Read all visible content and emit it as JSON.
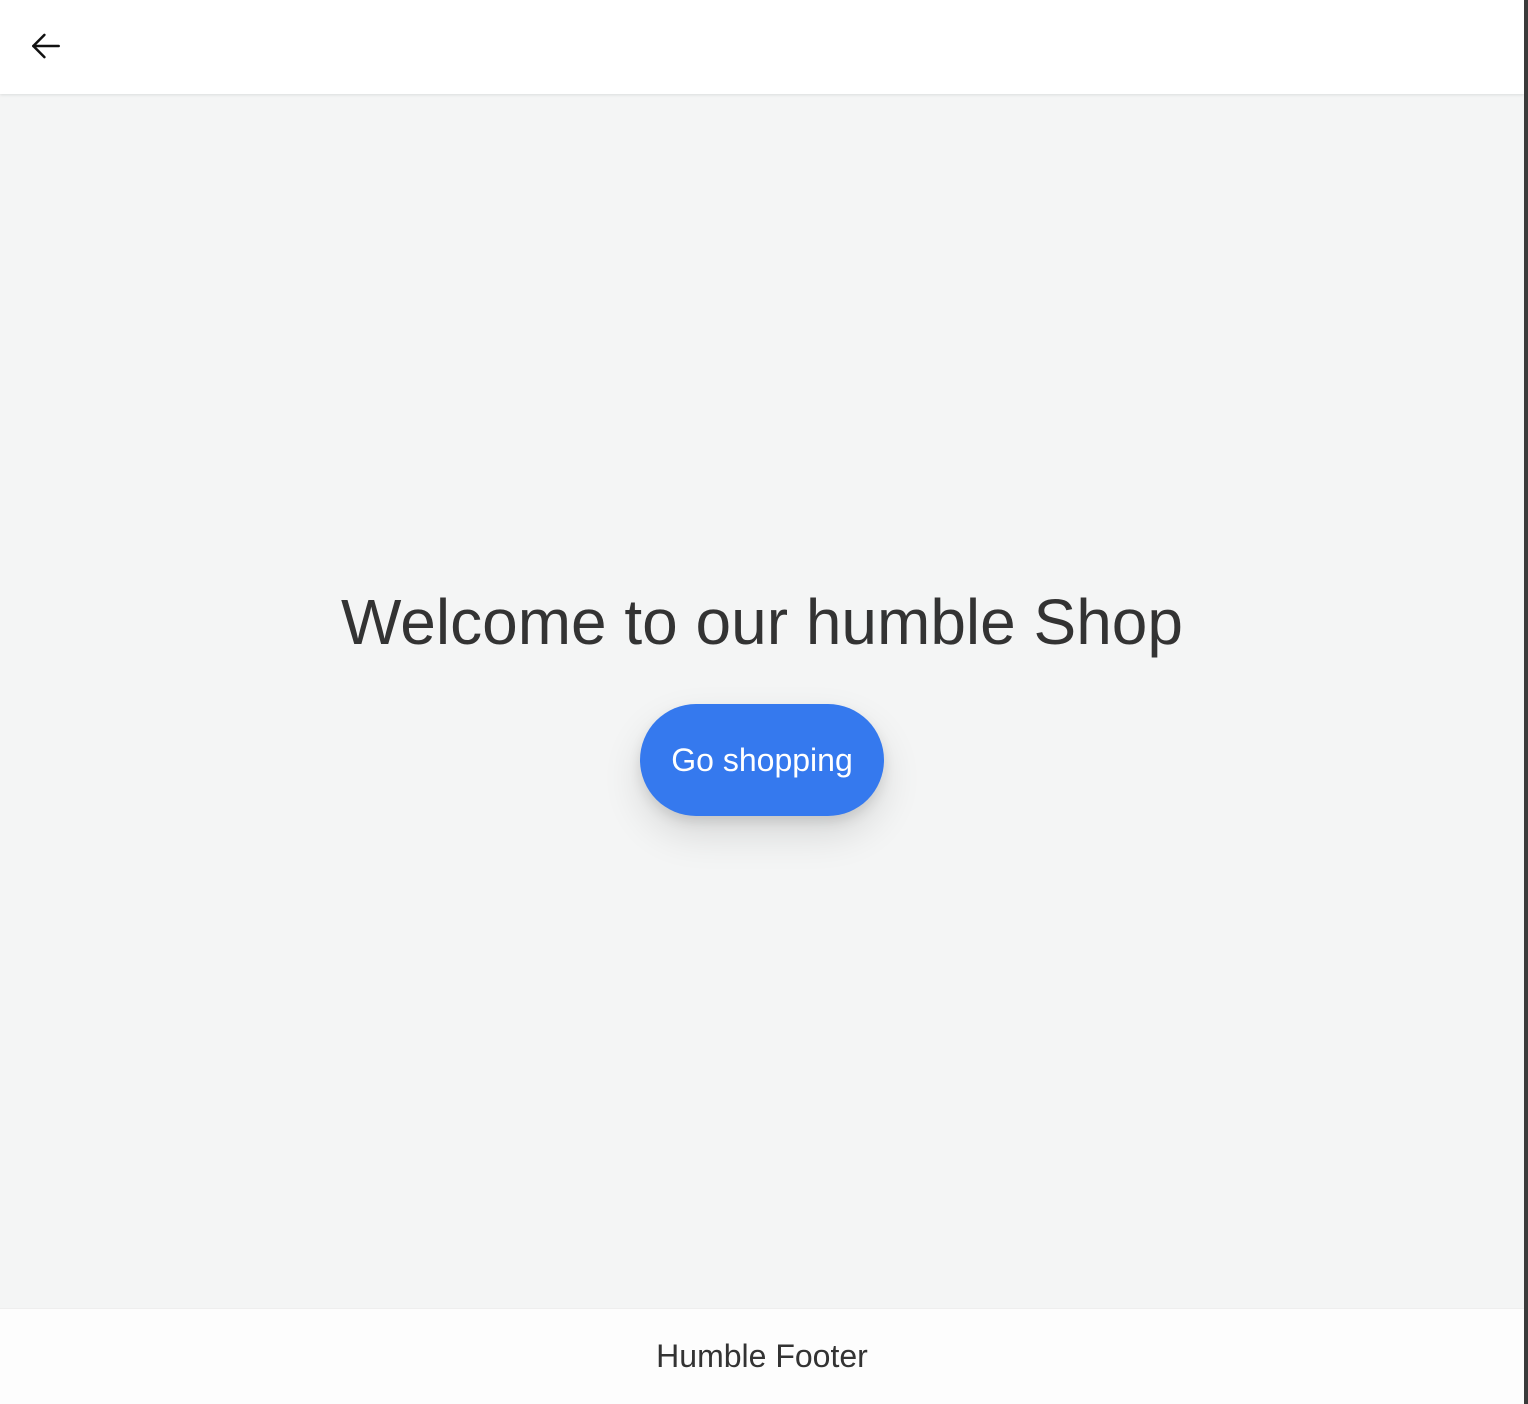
{
  "header": {
    "back_icon": "arrow-left-icon"
  },
  "main": {
    "title": "Welcome to our humble Shop",
    "cta_label": "Go shopping"
  },
  "footer": {
    "text": "Humble Footer"
  },
  "colors": {
    "background": "#f4f5f5",
    "header_bg": "#ffffff",
    "cta_bg": "#3579ee",
    "cta_text": "#ffffff",
    "text": "#333333"
  }
}
